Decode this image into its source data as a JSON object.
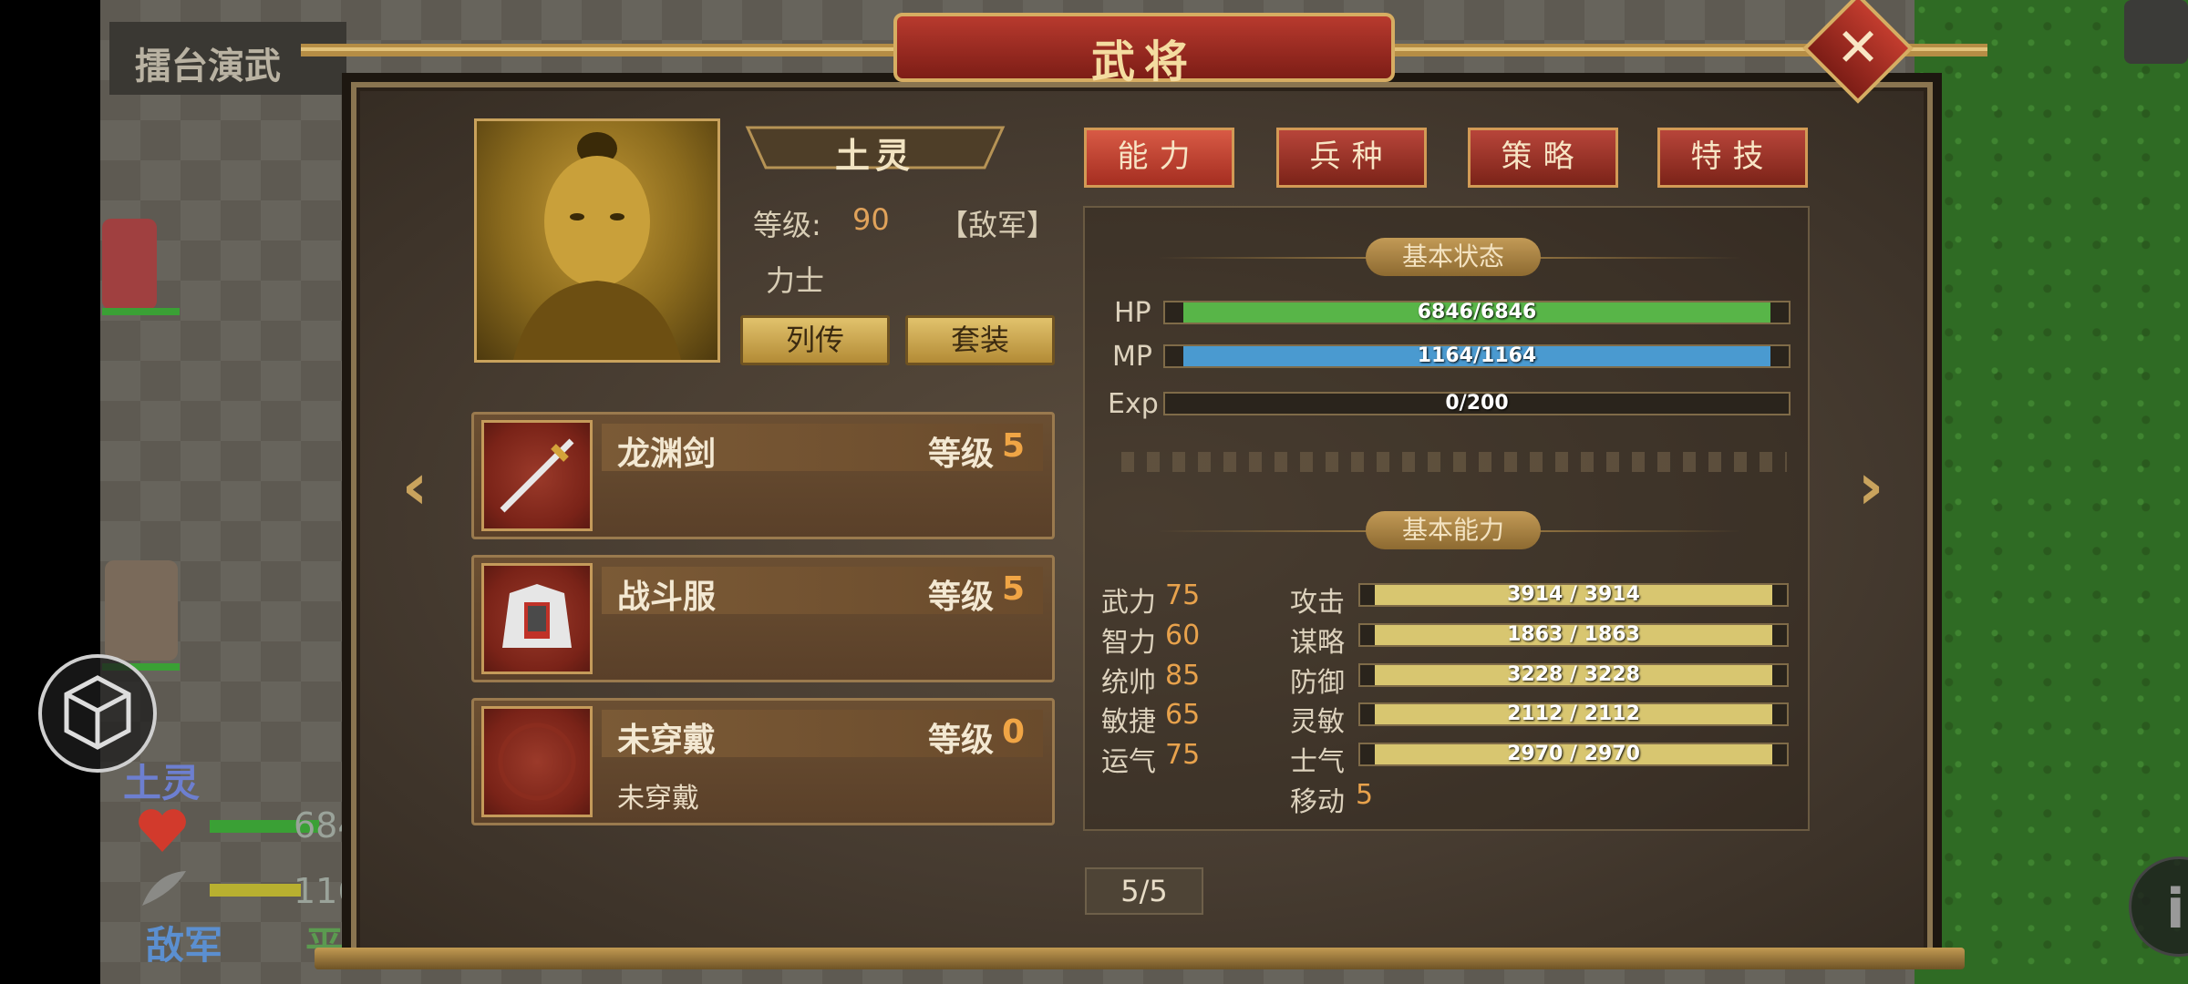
{
  "background": {
    "stage_title": "擂台演武",
    "unit_name": "土灵",
    "unit_hp_partial": "684",
    "unit_mp_partial": "116",
    "faction_left": "敌军",
    "faction_right": "平"
  },
  "dialog": {
    "title": "武将",
    "close_icon": "close-icon"
  },
  "general": {
    "name": "土灵",
    "level_label": "等级:",
    "level": "90",
    "faction_tag": "【敌军】",
    "class": "力士",
    "bio_button": "列传",
    "set_button": "套装"
  },
  "equipment": [
    {
      "name": "龙渊剑",
      "level_label": "等级",
      "level": "5",
      "sub": "",
      "icon": "sword-icon"
    },
    {
      "name": "战斗服",
      "level_label": "等级",
      "level": "5",
      "sub": "",
      "icon": "armor-icon"
    },
    {
      "name": "未穿戴",
      "level_label": "等级",
      "level": "0",
      "sub": "未穿戴",
      "icon": "empty-slot-icon"
    }
  ],
  "tabs": [
    "能力",
    "兵种",
    "策略",
    "特技"
  ],
  "active_tab": "能力",
  "basic_status": {
    "title": "基本状态",
    "bars": [
      {
        "label": "HP",
        "text": "6846/6846",
        "fraction": 1.0,
        "color": "#58b548"
      },
      {
        "label": "MP",
        "text": "1164/1164",
        "fraction": 1.0,
        "color": "#4a9ad0"
      },
      {
        "label": "Exp",
        "text": "0/200",
        "fraction": 0.0,
        "color": "#c9b24a"
      }
    ]
  },
  "basic_ability": {
    "title": "基本能力",
    "attributes": [
      {
        "name": "武力",
        "value": "75"
      },
      {
        "name": "智力",
        "value": "60"
      },
      {
        "name": "统帅",
        "value": "85"
      },
      {
        "name": "敏捷",
        "value": "65"
      },
      {
        "name": "运气",
        "value": "75"
      }
    ],
    "derived": [
      {
        "name": "攻击",
        "text": "3914 / 3914",
        "fraction": 1.0
      },
      {
        "name": "谋略",
        "text": "1863 / 1863",
        "fraction": 1.0
      },
      {
        "name": "防御",
        "text": "3228 / 3228",
        "fraction": 1.0
      },
      {
        "name": "灵敏",
        "text": "2112 / 2112",
        "fraction": 1.0
      },
      {
        "name": "士气",
        "text": "2970 / 2970",
        "fraction": 1.0
      }
    ],
    "move_label": "移动",
    "move_value": "5",
    "bar_color": "#d8c670"
  },
  "pagination": "5/5"
}
